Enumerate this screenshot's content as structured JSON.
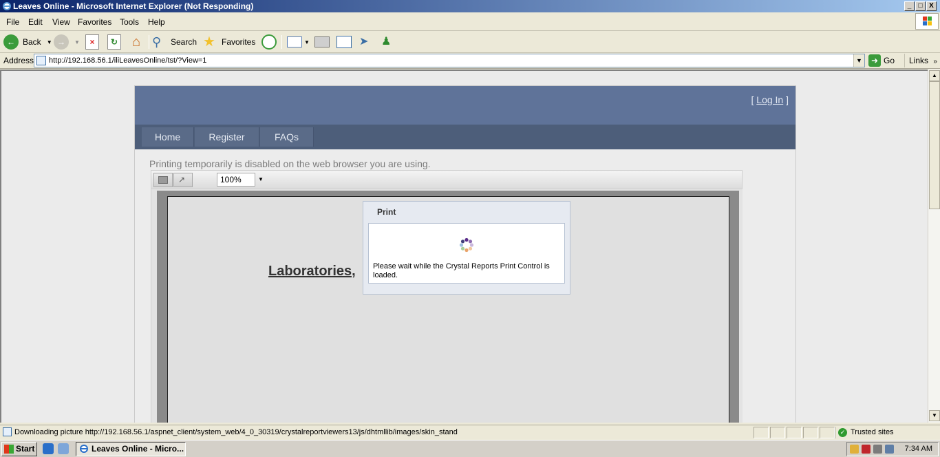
{
  "window": {
    "title": "Leaves Online - Microsoft Internet Explorer (Not Responding)",
    "controls": {
      "minimize": "_",
      "maximize": "□",
      "close": "X"
    }
  },
  "menubar": {
    "items": [
      {
        "label": "File",
        "key": "F"
      },
      {
        "label": "Edit",
        "key": "E"
      },
      {
        "label": "View",
        "key": "V"
      },
      {
        "label": "Favorites",
        "key": "a"
      },
      {
        "label": "Tools",
        "key": "T"
      },
      {
        "label": "Help",
        "key": "H"
      }
    ]
  },
  "toolbar": {
    "back_label": "Back",
    "search_label": "Search",
    "favorites_label": "Favorites"
  },
  "address": {
    "label": "Address",
    "url": "http://192.168.56.1/iliLeavesOnline/tst/?View=1",
    "go_label": "Go",
    "links_label": "Links"
  },
  "site": {
    "login_label": "Log In",
    "nav": [
      "Home",
      "Register",
      "FAQs"
    ],
    "print_message": "Printing temporarily is disabled on the web browser you are using."
  },
  "viewer": {
    "zoom": "100%",
    "report_heading": "Laboratories,"
  },
  "print_dialog": {
    "title": "Print",
    "message": "Please wait while the Crystal Reports Print Control is loaded."
  },
  "statusbar": {
    "text": "Downloading picture http://192.168.56.1/aspnet_client/system_web/4_0_30319/crystalreportviewers13/js/dhtmllib/images/skin_stand",
    "zone": "Trusted sites"
  },
  "taskbar": {
    "start_label": "Start",
    "task_label": "Leaves Online - Micro...",
    "clock": "7:34 AM"
  },
  "colors": {
    "site_header": "#5f7399",
    "site_nav": "#4d5e7a",
    "titlebar_start": "#0a246a"
  }
}
